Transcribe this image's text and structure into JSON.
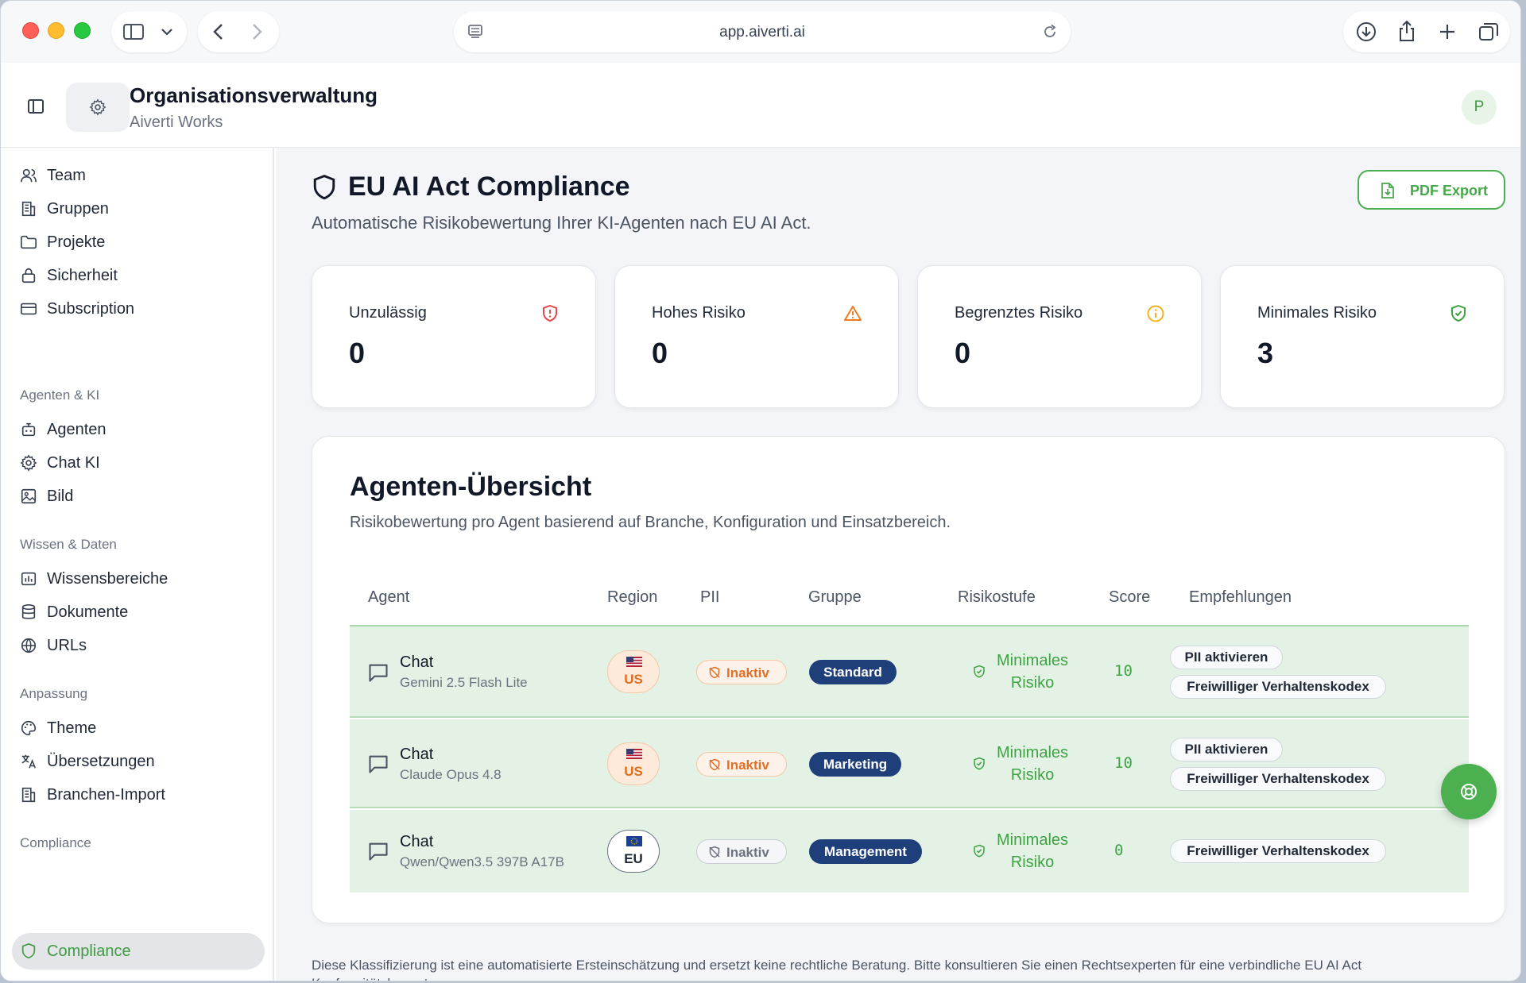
{
  "browser": {
    "url": "app.aiverti.ai"
  },
  "header": {
    "title": "Organisationsverwaltung",
    "subtitle": "Aiverti Works",
    "avatar_initial": "P"
  },
  "sidebar": {
    "items": [
      {
        "label": "Team",
        "icon": "users-icon"
      },
      {
        "label": "Gruppen",
        "icon": "building-icon"
      },
      {
        "label": "Projekte",
        "icon": "folder-icon"
      },
      {
        "label": "Sicherheit",
        "icon": "lock-icon"
      },
      {
        "label": "Subscription",
        "icon": "credit-card-icon"
      }
    ],
    "sections": [
      {
        "label": "Agenten & KI",
        "items": [
          {
            "label": "Agenten",
            "icon": "bot-icon"
          },
          {
            "label": "Chat KI",
            "icon": "gear-icon"
          },
          {
            "label": "Bild",
            "icon": "image-icon"
          }
        ]
      },
      {
        "label": "Wissen & Daten",
        "items": [
          {
            "label": "Wissensbereiche",
            "icon": "chart-box-icon"
          },
          {
            "label": "Dokumente",
            "icon": "database-icon"
          },
          {
            "label": "URLs",
            "icon": "globe-icon"
          }
        ]
      },
      {
        "label": "Anpassung",
        "items": [
          {
            "label": "Theme",
            "icon": "palette-icon"
          },
          {
            "label": "Übersetzungen",
            "icon": "translate-icon"
          },
          {
            "label": "Branchen-Import",
            "icon": "building-icon"
          }
        ]
      },
      {
        "label": "Compliance",
        "items": [
          {
            "label": "Compliance",
            "icon": "shield-icon",
            "active": true
          }
        ]
      }
    ]
  },
  "main": {
    "title": "EU AI Act Compliance",
    "subtitle": "Automatische Risikobewertung Ihrer KI-Agenten nach EU AI Act.",
    "pdf_export_label": "PDF Export",
    "stats": [
      {
        "label": "Unzulässig",
        "value": "0",
        "icon": "shield-alert-icon",
        "color": "#e5484d"
      },
      {
        "label": "Hohes Risiko",
        "value": "0",
        "icon": "warning-triangle-icon",
        "color": "#f07a22"
      },
      {
        "label": "Begrenztes Risiko",
        "value": "0",
        "icon": "info-circle-icon",
        "color": "#f5b021"
      },
      {
        "label": "Minimales Risiko",
        "value": "3",
        "icon": "shield-check-icon",
        "color": "#3fa243"
      }
    ],
    "overview": {
      "title": "Agenten-Übersicht",
      "subtitle": "Risikobewertung pro Agent basierend auf Branche, Konfiguration und Einsatzbereich.",
      "columns": [
        "Agent",
        "Region",
        "PII",
        "Gruppe",
        "Risikostufe",
        "Score",
        "Empfehlungen"
      ],
      "rows": [
        {
          "agent": "Chat",
          "model": "Gemini 2.5 Flash Lite",
          "region": "US",
          "pii": "Inaktiv",
          "group": "Standard",
          "risk_line1": "Minimales",
          "risk_line2": "Risiko",
          "score": "10",
          "recs": [
            "PII aktivieren",
            "Freiwilliger Verhaltenskodex"
          ]
        },
        {
          "agent": "Chat",
          "model": "Claude Opus 4.8",
          "region": "US",
          "pii": "Inaktiv",
          "group": "Marketing",
          "risk_line1": "Minimales",
          "risk_line2": "Risiko",
          "score": "10",
          "recs": [
            "PII aktivieren",
            "Freiwilliger Verhaltenskodex"
          ]
        },
        {
          "agent": "Chat",
          "model": "Qwen/Qwen3.5 397B A17B",
          "region": "EU",
          "pii": "Inaktiv",
          "group": "Management",
          "risk_line1": "Minimales",
          "risk_line2": "Risiko",
          "score": "0",
          "recs": [
            "Freiwilliger Verhaltenskodex"
          ]
        }
      ]
    },
    "disclaimer": "Diese Klassifizierung ist eine automatisierte Ersteinschätzung und ersetzt keine rechtliche Beratung. Bitte konsultieren Sie einen Rechtsexperten für eine verbindliche EU AI Act Konformitätsbewertung."
  },
  "colors": {
    "accent": "#4caf50",
    "group_badge": "#1f3f7a",
    "row_bg": "#e4f2e6"
  }
}
